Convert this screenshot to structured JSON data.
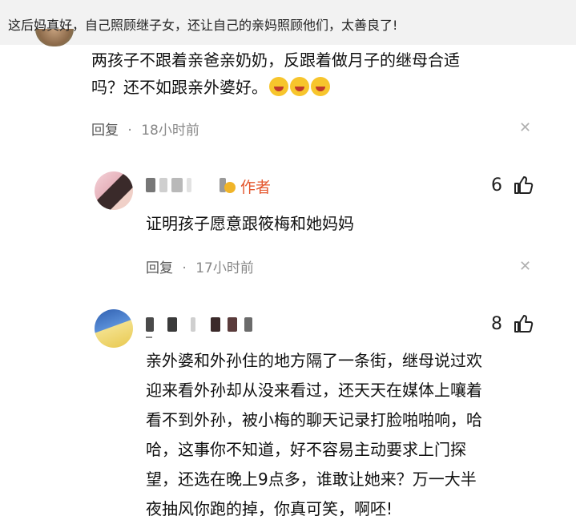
{
  "parent_comment": {
    "quoted_text": "这后妈真好，自己照顾继子女，还让自己的亲妈照顾他们，太善良了!",
    "body": "两孩子不跟着亲爸亲奶奶，反跟着做月子的继母合适吗？还不如跟亲外婆好。",
    "body_line1": "两孩子不跟着亲爸亲奶奶，反跟着做月子的继母合适",
    "body_line2": "吗？还不如跟亲外婆好。",
    "emoji": "laughing-crying",
    "reply_label": "回复",
    "separator": "·",
    "time": "18小时前"
  },
  "replies": [
    {
      "badge": "作者",
      "likes": "6",
      "body": "证明孩子愿意跟筱梅和她妈妈",
      "reply_label": "回复",
      "separator": "·",
      "time": "17小时前"
    },
    {
      "likes": "8",
      "body_lines": [
        "亲外婆和外孙住的地方隔了一条街，继母说过欢",
        "迎来看外孙却从没来看过，还天天在媒体上嚷着",
        "看不到外孙，被小梅的聊天记录打脸啪啪响，哈",
        "哈，这事你不知道，好不容易主动要求上门探",
        "望，还选在晚上9点多，谁敢让她来？万一大半",
        "夜抽风你跑的掉，你真可笑，啊呸!"
      ]
    }
  ],
  "colors": {
    "author_badge": "#e4572e",
    "meta": "#888888",
    "background": "#ffffff"
  }
}
